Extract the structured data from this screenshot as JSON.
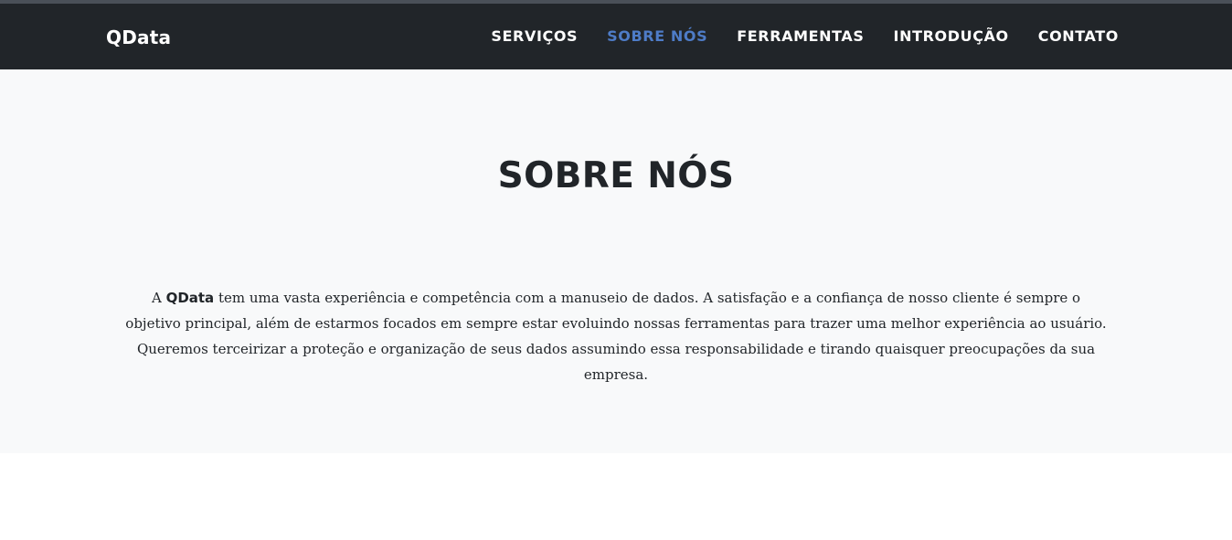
{
  "navbar": {
    "brand": "QData",
    "items": [
      {
        "label": "SERVIÇOS",
        "active": false
      },
      {
        "label": "SOBRE NÓS",
        "active": true
      },
      {
        "label": "FERRAMENTAS",
        "active": false
      },
      {
        "label": "INTRODUÇÃO",
        "active": false
      },
      {
        "label": "CONTATO",
        "active": false
      }
    ],
    "active_color": "#4e7cc7",
    "background": "#212529"
  },
  "about": {
    "title": "SOBRE NÓS",
    "text_prefix": "A ",
    "text_brand": "QData",
    "text_body": " tem uma vasta experiência e competência com a manuseio de dados. A satisfação e a confiança de nosso cliente é sempre o objetivo principal, além de estarmos focados em sempre estar evoluindo nossas ferramentas para trazer uma melhor experiência ao usuário. Queremos terceirizar a proteção e organização de seus dados assumindo essa responsabilidade e tirando quaisquer preocupações da sua empresa.",
    "background": "#f8f9fa"
  }
}
